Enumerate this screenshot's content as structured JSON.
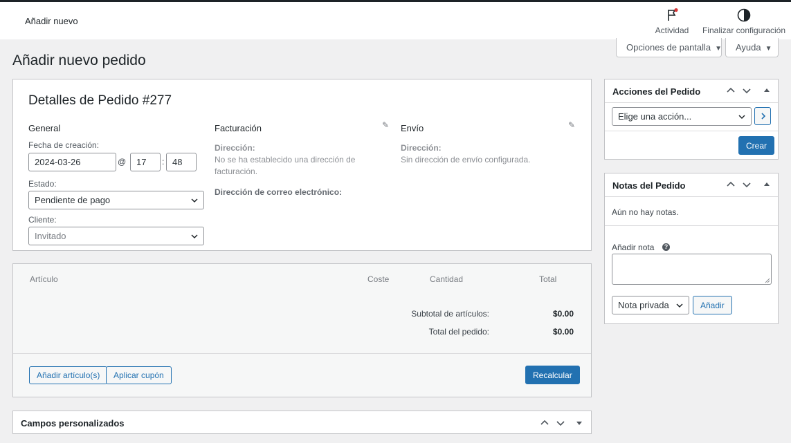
{
  "header": {
    "title": "Añadir nuevo",
    "activity_label": "Actividad",
    "finish_setup_label": "Finalizar configuración",
    "accent": "#d63638"
  },
  "screen_options": {
    "label": "Opciones de pantalla"
  },
  "help": {
    "label": "Ayuda"
  },
  "page": {
    "title": "Añadir nuevo pedido"
  },
  "order": {
    "heading": "Detalles de Pedido #277",
    "general": {
      "heading": "General",
      "date_label": "Fecha de creación:",
      "date_value": "2024-03-26",
      "at": "@",
      "hour": "17",
      "colon": ":",
      "minute": "48",
      "status_label": "Estado:",
      "status_value": "Pendiente de pago",
      "customer_label": "Cliente:",
      "customer_value": "Invitado"
    },
    "billing": {
      "heading": "Facturación",
      "address_label": "Dirección:",
      "address_text": "No se ha establecido una dirección de facturación.",
      "email_label": "Dirección de correo electrónico:"
    },
    "shipping": {
      "heading": "Envío",
      "address_label": "Dirección:",
      "address_text": "Sin dirección de envío configurada."
    }
  },
  "items": {
    "columns": [
      "Artículo",
      "Coste",
      "Cantidad",
      "Total"
    ],
    "subtotal_label": "Subtotal de artículos:",
    "subtotal_value": "$0.00",
    "total_label": "Total del pedido:",
    "total_value": "$0.00",
    "add_item_label": "Añadir artículo(s)",
    "apply_coupon_label": "Aplicar cupón",
    "recalc_label": "Recalcular"
  },
  "custom_fields": {
    "title": "Campos personalizados"
  },
  "actions": {
    "title": "Acciones del Pedido",
    "select_value": "Elige una acción...",
    "create_label": "Crear"
  },
  "notes": {
    "title": "Notas del Pedido",
    "empty_text": "Aún no hay notas.",
    "add_note_label": "Añadir nota",
    "note_type_value": "Nota privada",
    "add_button": "Añadir"
  },
  "colors": {
    "primary": "#2271b1"
  }
}
